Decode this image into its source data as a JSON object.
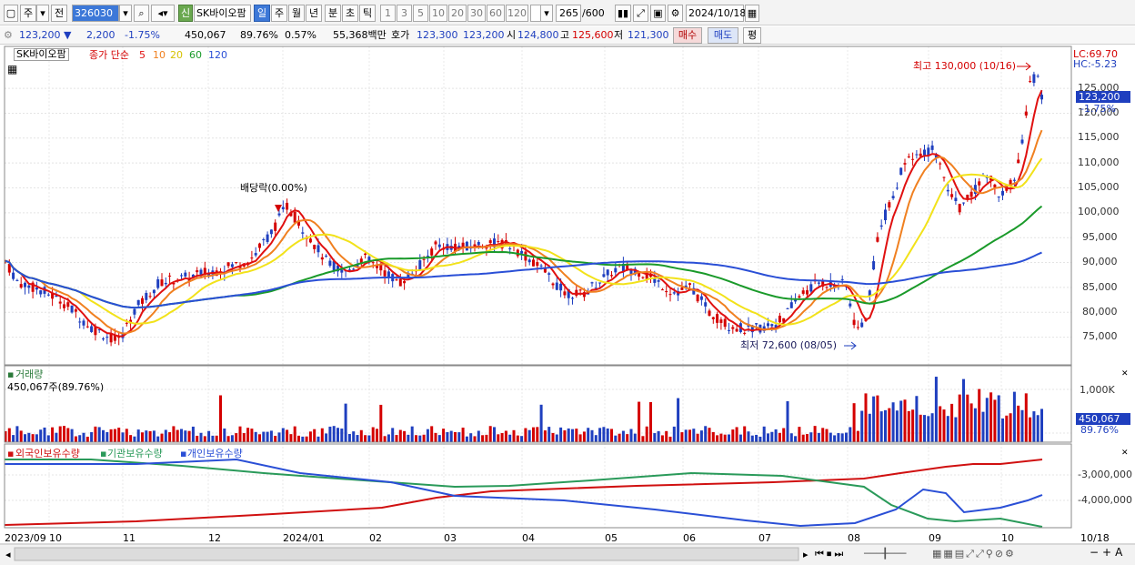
{
  "toolbar": {
    "market": "주",
    "prev": "전",
    "code": "326030",
    "new_badge": "신",
    "name": "SK바이오팜",
    "periods": [
      "일",
      "주",
      "월",
      "년",
      "분",
      "초",
      "틱"
    ],
    "intervals": [
      "1",
      "3",
      "5",
      "10",
      "20",
      "30",
      "60",
      "120"
    ],
    "count": "265",
    "count_total": "/600",
    "date": "2024/10/18"
  },
  "quote": {
    "price": "123,200 ▼",
    "change": "2,200",
    "change_pct": "-1.75%",
    "volume": "450,067",
    "vol_ratio": "89.76%",
    "turnover": "0.57%",
    "amount": "55,368백만",
    "bid_label": "호가",
    "bid": "123,300",
    "ask": "123,200",
    "open_label": "시",
    "open": "124,800",
    "high_label": "고",
    "high": "125,600",
    "low_label": "저",
    "low": "121,300",
    "buy_button": "매수",
    "sell_button": "매도",
    "eval_button": "평"
  },
  "price_panel": {
    "legend_name": "SK바이오팜",
    "legend_ma": "종가 단순",
    "ma_periods": [
      "5",
      "10",
      "20",
      "60",
      "120"
    ],
    "ma_colors": [
      "#e01010",
      "#f08020",
      "#f2e21a",
      "#1a9a2a",
      "#2a4fd6"
    ],
    "lc": "LC:69.70",
    "hc": "HC:-5.23",
    "current_price": "123,200",
    "current_pct": "-1.75%",
    "high_annotation": "최고 130,000 (10/16)",
    "low_annotation": "최저 72,600 (08/05)",
    "dividend_annotation": "배당락(0.00%)",
    "y_ticks": [
      "125,000",
      "120,000",
      "115,000",
      "110,000",
      "105,000",
      "100,000",
      "95,000",
      "90,000",
      "85,000",
      "80,000",
      "75,000"
    ]
  },
  "volume_panel": {
    "title": "거래량",
    "value": "450,067주(89.76%)",
    "tick": "1,000K",
    "current": "450,067",
    "current_pct": "89.76%"
  },
  "holding_panel": {
    "series": [
      "외국인보유수량",
      "기관보유수량",
      "개인보유수량"
    ],
    "colors": [
      "#d01010",
      "#2a9a5a",
      "#2a4fd6"
    ],
    "ticks": [
      "-3,000,000",
      "-4,000,000"
    ]
  },
  "x_axis": {
    "labels": [
      "2023/09",
      "10",
      "11",
      "12",
      "2024/01",
      "02",
      "03",
      "04",
      "05",
      "06",
      "07",
      "08",
      "09",
      "10"
    ],
    "right_label": "10/18"
  }
}
